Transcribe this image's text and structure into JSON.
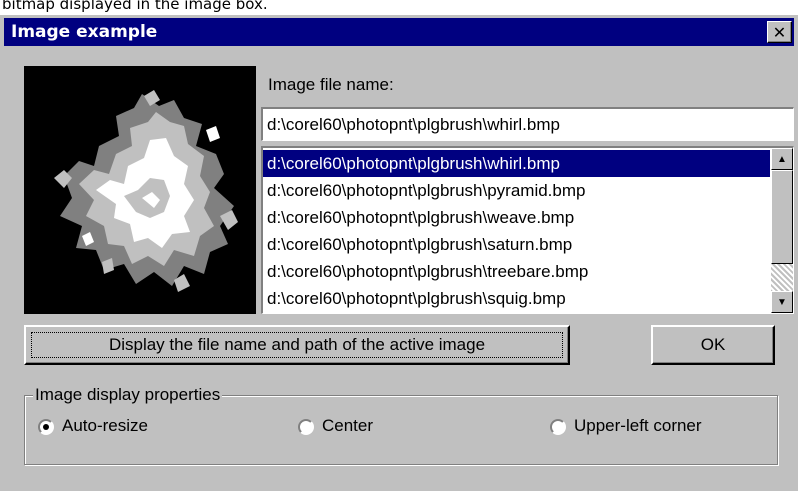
{
  "caption": "bitmap displayed in the image box.",
  "window": {
    "title": "Image example",
    "close_glyph": "✕"
  },
  "image_label": "Image file name:",
  "file_input_value": "d:\\corel60\\photopnt\\plgbrush\\whirl.bmp",
  "file_list": [
    "d:\\corel60\\photopnt\\plgbrush\\whirl.bmp",
    "d:\\corel60\\photopnt\\plgbrush\\pyramid.bmp",
    "d:\\corel60\\photopnt\\plgbrush\\weave.bmp",
    "d:\\corel60\\photopnt\\plgbrush\\saturn.bmp",
    "d:\\corel60\\photopnt\\plgbrush\\treebare.bmp",
    "d:\\corel60\\photopnt\\plgbrush\\squig.bmp"
  ],
  "selected_index": 0,
  "buttons": {
    "display_label": "Display the file name and path of the active image",
    "ok_label": "OK"
  },
  "display_group": {
    "legend": "Image display properties",
    "options": [
      "Auto-resize",
      "Center",
      "Upper-left corner"
    ],
    "selected": 0
  },
  "colors": {
    "title_bar": "#000080",
    "dialog_face": "#c0c0c0",
    "selection": "#000080"
  }
}
